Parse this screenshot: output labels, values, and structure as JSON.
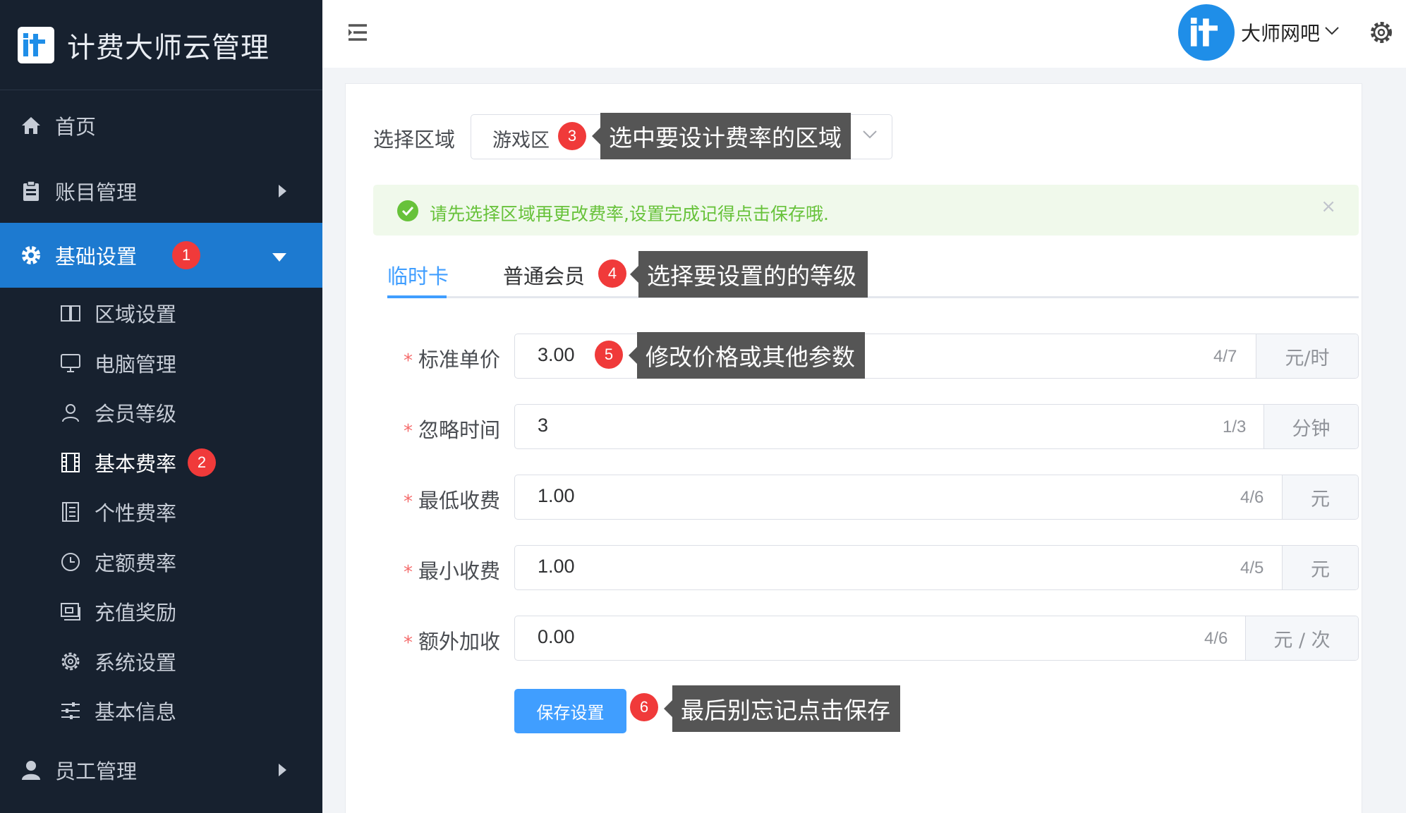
{
  "app": {
    "title": "计费大师云管理"
  },
  "sidebar": {
    "menus": [
      {
        "label": "首页",
        "icon": "home-icon"
      },
      {
        "label": "账目管理",
        "icon": "clipboard-icon"
      },
      {
        "label": "基础设置",
        "icon": "gear-icon",
        "badge": "1"
      },
      {
        "label": "员工管理",
        "icon": "user-icon"
      }
    ],
    "submenus": [
      {
        "label": "区域设置",
        "icon": "book-icon"
      },
      {
        "label": "电脑管理",
        "icon": "monitor-icon"
      },
      {
        "label": "会员等级",
        "icon": "person-icon"
      },
      {
        "label": "基本费率",
        "icon": "film-icon",
        "badge": "2"
      },
      {
        "label": "个性费率",
        "icon": "list-icon"
      },
      {
        "label": "定额费率",
        "icon": "clock-icon"
      },
      {
        "label": "充值奖励",
        "icon": "wallet-icon"
      },
      {
        "label": "系统设置",
        "icon": "cog-icon"
      },
      {
        "label": "基本信息",
        "icon": "sliders-icon"
      }
    ]
  },
  "topbar": {
    "user_name": "大师网吧"
  },
  "region": {
    "label": "选择区域",
    "value": "游戏区",
    "badge": "3",
    "callout": "选中要设计费率的区域"
  },
  "alert": {
    "text": "请先选择区域再更改费率,设置完成记得点击保存哦.",
    "close": "×"
  },
  "tabs": {
    "items": [
      "临时卡",
      "普通会员"
    ],
    "badge": "4",
    "callout": "选择要设置的的等级"
  },
  "form": {
    "fields": [
      {
        "label": "标准单价",
        "value": "3.00",
        "count": "4/7",
        "unit": "元/时"
      },
      {
        "label": "忽略时间",
        "value": "3",
        "count": "1/3",
        "unit": "分钟"
      },
      {
        "label": "最低收费",
        "value": "1.00",
        "count": "4/6",
        "unit": "元"
      },
      {
        "label": "最小收费",
        "value": "1.00",
        "count": "4/5",
        "unit": "元"
      },
      {
        "label": "额外加收",
        "value": "0.00",
        "count": "4/6",
        "unit": "元 / 次"
      }
    ],
    "required_mark": "*",
    "price_badge": "5",
    "price_callout": "修改价格或其他参数",
    "save_label": "保存设置",
    "save_badge": "6",
    "save_callout": "最后别忘记点击保存"
  },
  "colors": {
    "sidebar_bg": "#17212f",
    "active_menu": "#1d7ad0",
    "primary": "#409eff",
    "success": "#67c23a",
    "badge": "#f03a3a",
    "callout_bg": "#555555"
  }
}
